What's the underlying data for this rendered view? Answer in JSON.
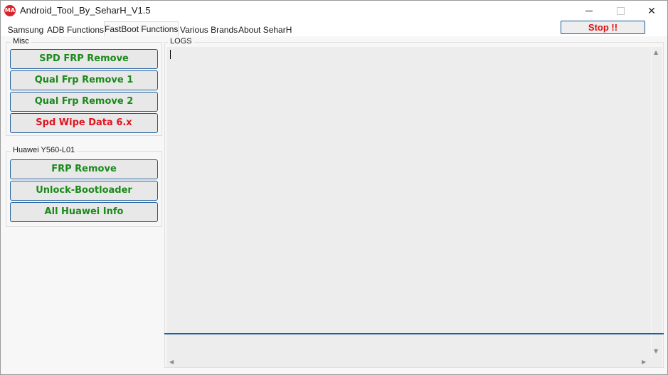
{
  "window": {
    "title": "Android_Tool_By_SeharH_V1.5",
    "app_icon_text": "MA",
    "controls": {
      "minimize": "minimize",
      "maximize": "maximize",
      "close": "✕"
    }
  },
  "tabs": [
    {
      "label": "Samsung",
      "active": false
    },
    {
      "label": "ADB Functions",
      "active": false
    },
    {
      "label": "FastBoot Functions",
      "active": true
    },
    {
      "label": "Various Brands",
      "active": false
    },
    {
      "label": "About SeharH",
      "active": false
    }
  ],
  "stop_button": {
    "label": "Stop !!"
  },
  "misc_group": {
    "title": "Misc",
    "buttons": [
      {
        "label": "SPD FRP Remove",
        "color": "#1b8a1b"
      },
      {
        "label": "Qual Frp Remove 1",
        "color": "#1b8a1b"
      },
      {
        "label": "Qual Frp Remove 2",
        "color": "#1b8a1b"
      },
      {
        "label": "Spd Wipe Data 6.x",
        "color": "#e0141e"
      }
    ]
  },
  "huawei_group": {
    "title": "Huawei Y560-L01",
    "buttons": [
      {
        "label": "FRP Remove",
        "color": "#1b8a1b"
      },
      {
        "label": "Unlock-Bootloader",
        "color": "#1b8a1b"
      },
      {
        "label": "All Huawei Info",
        "color": "#1b8a1b"
      }
    ]
  },
  "logs": {
    "title": "LOGS",
    "content": ""
  },
  "icons": {
    "scroll_up": "▲",
    "scroll_down": "▼",
    "scroll_left": "◀",
    "scroll_right": "▶"
  }
}
